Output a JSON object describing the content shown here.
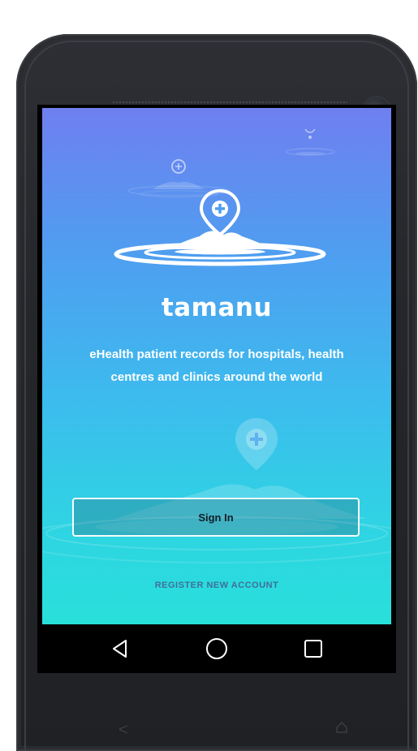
{
  "app": {
    "brand_name": "tamanu",
    "tagline_line1": "eHealth patient records for hospitals, health",
    "tagline_line2": "centres and clinics around the world"
  },
  "actions": {
    "sign_in_label": "Sign In",
    "register_label": "REGISTER NEW ACCOUNT"
  },
  "navigation": {
    "back_icon": "triangle-back-icon",
    "home_icon": "circle-home-icon",
    "recents_icon": "square-recents-icon"
  },
  "colors": {
    "gradient_top": "#6f7ff0",
    "gradient_bottom": "#28e0da",
    "button_border": "#ffffff",
    "register_text": "#3f6f9a"
  }
}
